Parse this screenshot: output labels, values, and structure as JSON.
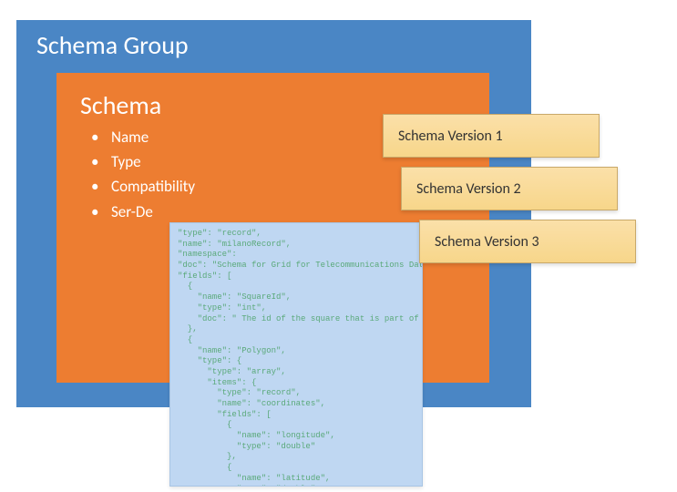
{
  "group": {
    "title": "Schema Group"
  },
  "schema": {
    "title": "Schema",
    "props": [
      "Name",
      "Type",
      "Compatibility",
      "Ser-De"
    ]
  },
  "versions": [
    {
      "label": "Schema Version 1"
    },
    {
      "label": "Schema Version 2"
    },
    {
      "label": "Schema Version 3"
    }
  ],
  "code": "\"type\": \"record\",\n\"name\": \"milanoRecord\",\n\"namespace\":\n\"doc\": \"Schema for Grid for Telecommunications Data from Tel\n\"fields\": [\n  {\n    \"name\": \"SquareId\",\n    \"type\": \"int\",\n    \"doc\": \" The id of the square that is part of t\n  },\n  {\n    \"name\": \"Polygon\",\n    \"type\": {\n      \"type\": \"array\",\n      \"items\": {\n        \"type\": \"record\",\n        \"name\": \"coordinates\",\n        \"fields\": [\n          {\n            \"name\": \"longitude\",\n            \"type\": \"double\"\n          },\n          {\n            \"name\": \"latitude\",\n            \"type\": \"double\"\n          }\n        ]\n      }\n    }\n  }\n"
}
